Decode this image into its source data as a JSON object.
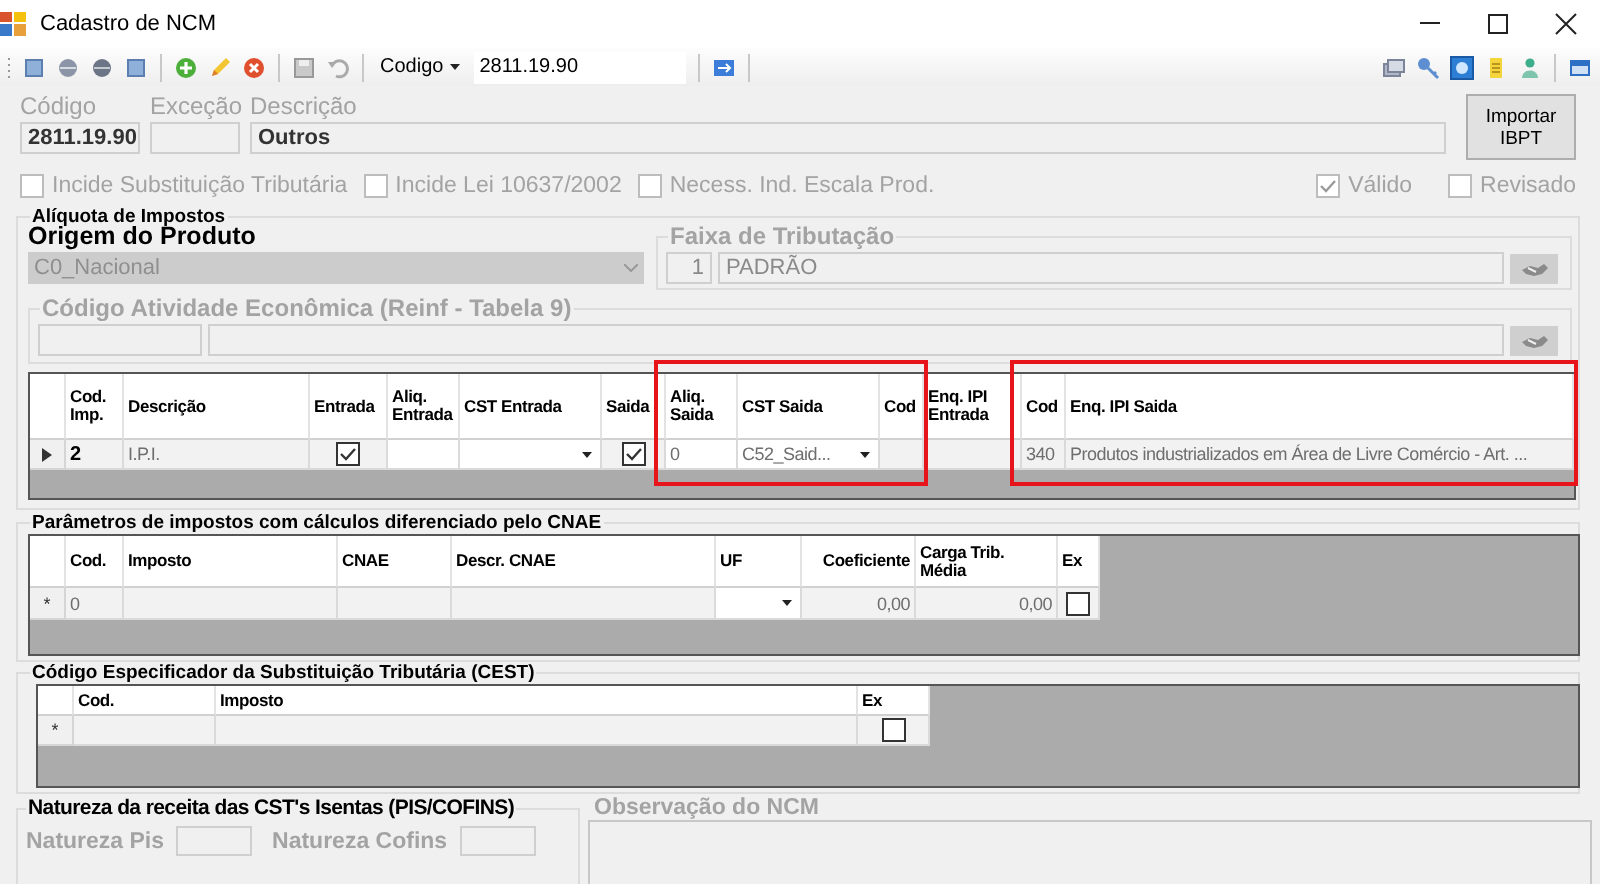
{
  "window": {
    "title": "Cadastro de NCM"
  },
  "toolbar": {
    "search_by": "Codigo",
    "search_value": "2811.19.90"
  },
  "header": {
    "fields": [
      {
        "label": "Código",
        "value": "2811.19.90"
      },
      {
        "label": "Exceção"
      },
      {
        "label": "Descrição",
        "value": "Outros"
      }
    ],
    "import_button": "Importar IBPT"
  },
  "options": [
    {
      "label": "Incide Substituição Tributária",
      "checked": false
    },
    {
      "label": "Incide Lei 10637/2002",
      "checked": false
    },
    {
      "label": "Necess. Ind. Escala Prod.",
      "checked": false
    }
  ],
  "status_options": [
    {
      "label": "Válido",
      "checked": true
    },
    {
      "label": "Revisado",
      "checked": false
    }
  ],
  "aliquota": {
    "title": "Alíquota de Impostos",
    "origin_label": "Origem do Produto",
    "origin_value": "C0_Nacional",
    "tax_range": {
      "title": "Faixa de Tributação",
      "code": "1",
      "name": "PADRÃO"
    },
    "activity": {
      "title": "Código Atividade Econômica (Reinf - Tabela 9)"
    },
    "grid": {
      "columns": [
        {
          "label": "Cod. Imp."
        },
        {
          "label": "Descrição"
        },
        {
          "label": "Entrada"
        },
        {
          "label": "Aliq. Entrada"
        },
        {
          "label": "CST Entrada"
        },
        {
          "label": "Saida"
        },
        {
          "label": "Aliq. Saida",
          "highlight": true
        },
        {
          "label": "CST Saida",
          "highlight": true
        },
        {
          "label": "Cod",
          "highlight": true
        },
        {
          "label": "Enq. IPI Entrada"
        },
        {
          "label": "Cod",
          "highlight": true
        },
        {
          "label": "Enq. IPI Saida",
          "highlight": true
        }
      ],
      "rows": [
        {
          "current": true,
          "cells": [
            {
              "kind": "key",
              "value": "2"
            },
            {
              "kind": "text",
              "value": "I.P.I."
            },
            {
              "kind": "check",
              "checked": true
            },
            {
              "kind": "input"
            },
            {
              "kind": "combo"
            },
            {
              "kind": "check",
              "checked": true
            },
            {
              "kind": "input",
              "value": "0"
            },
            {
              "kind": "combo",
              "value": "C52_Said..."
            },
            {
              "kind": "text"
            },
            {
              "kind": "text"
            },
            {
              "kind": "text",
              "value": "340"
            },
            {
              "kind": "text",
              "value": "Produtos industrializados em Área de Livre Comércio - Art. ..."
            }
          ]
        }
      ]
    }
  },
  "cnae_params": {
    "title": "Parâmetros de impostos com cálculos diferenciado pelo CNAE",
    "grid": {
      "columns": [
        {
          "label": "Cod."
        },
        {
          "label": "Imposto"
        },
        {
          "label": "CNAE"
        },
        {
          "label": "Descr. CNAE"
        },
        {
          "label": "UF"
        },
        {
          "label": "Coeficiente"
        },
        {
          "label": "Carga Trib. Média"
        },
        {
          "label": "Ex"
        }
      ],
      "rows": [
        {
          "current": false,
          "marker": "*",
          "cells": [
            {
              "kind": "text",
              "value": "0"
            },
            {
              "kind": "text"
            },
            {
              "kind": "text"
            },
            {
              "kind": "text"
            },
            {
              "kind": "combo"
            },
            {
              "kind": "number",
              "value": "0,00"
            },
            {
              "kind": "number",
              "value": "0,00"
            },
            {
              "kind": "check",
              "checked": false
            }
          ]
        }
      ]
    }
  },
  "cest": {
    "title": "Código Especificador da Substituição Tributária (CEST)",
    "grid": {
      "columns": [
        {
          "label": "Cod."
        },
        {
          "label": "Imposto"
        },
        {
          "label": "Ex"
        }
      ],
      "rows": [
        {
          "current": false,
          "marker": "*",
          "cells": [
            {
              "kind": "text"
            },
            {
              "kind": "text"
            },
            {
              "kind": "check",
              "checked": false
            }
          ]
        }
      ]
    }
  },
  "revenue_nature": {
    "title": "Natureza da receita das CST's Isentas (PIS/COFINS)",
    "fields": [
      {
        "label": "Natureza Pis"
      },
      {
        "label": "Natureza Cofins"
      }
    ]
  },
  "observation": {
    "title": "Observação do NCM"
  }
}
